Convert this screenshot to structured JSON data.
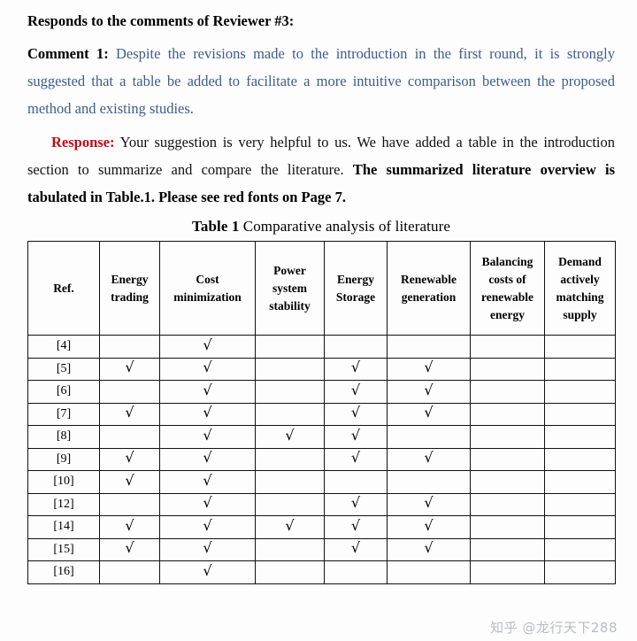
{
  "document": {
    "heading": "Responds to the comments of Reviewer #3:",
    "comment": {
      "label": "Comment 1:",
      "body": "Despite the revisions made to the introduction in the first round, it is strongly suggested that a table be added to facilitate a more intuitive comparison between the proposed method and existing studies.",
      "color": "#3f5b8e"
    },
    "response": {
      "label": "Response:",
      "label_color": "#c10b17",
      "body_normal": "Your suggestion is very helpful to us. We have added a table in the introduction section to summarize and compare the literature.",
      "body_bold": "The summarized literature overview is tabulated in Table.1. Please see red fonts on Page 7."
    }
  },
  "table": {
    "caption_strong": "Table 1",
    "caption_rest": " Comparative analysis of literature",
    "headers": [
      "Ref.",
      "Energy trading",
      "Cost minimization",
      "Power system stability",
      "Energy Storage",
      "Renewable generation",
      "Balancing costs of renewable energy",
      "Demand actively matching supply"
    ],
    "check_symbol": "√",
    "rows": [
      {
        "ref": "[4]",
        "marks": [
          false,
          true,
          false,
          false,
          false,
          false,
          false
        ]
      },
      {
        "ref": "[5]",
        "marks": [
          true,
          true,
          false,
          true,
          true,
          false,
          false
        ]
      },
      {
        "ref": "[6]",
        "marks": [
          false,
          true,
          false,
          true,
          true,
          false,
          false
        ]
      },
      {
        "ref": "[7]",
        "marks": [
          true,
          true,
          false,
          true,
          true,
          false,
          false
        ]
      },
      {
        "ref": "[8]",
        "marks": [
          false,
          true,
          true,
          true,
          false,
          false,
          false
        ]
      },
      {
        "ref": "[9]",
        "marks": [
          true,
          true,
          false,
          true,
          true,
          false,
          false
        ]
      },
      {
        "ref": "[10]",
        "marks": [
          true,
          true,
          false,
          false,
          false,
          false,
          false
        ]
      },
      {
        "ref": "[12]",
        "marks": [
          false,
          true,
          false,
          true,
          true,
          false,
          false
        ]
      },
      {
        "ref": "[14]",
        "marks": [
          true,
          true,
          true,
          true,
          true,
          false,
          false
        ]
      },
      {
        "ref": "[15]",
        "marks": [
          true,
          true,
          false,
          true,
          true,
          false,
          false
        ]
      },
      {
        "ref": "[16]",
        "marks": [
          false,
          true,
          false,
          false,
          false,
          false,
          false
        ]
      }
    ]
  },
  "watermark": {
    "text": "知乎 @龙行天下288"
  }
}
